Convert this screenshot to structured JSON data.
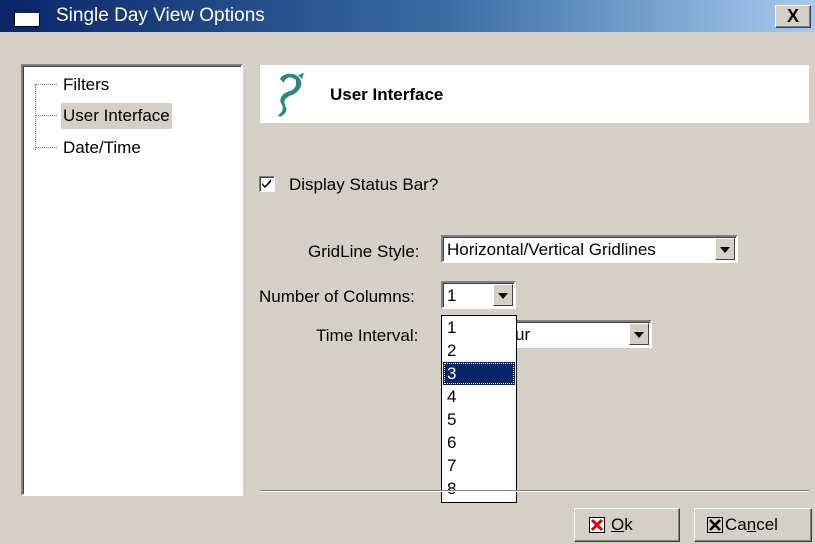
{
  "window": {
    "title": "Single Day View Options",
    "close_label": "X"
  },
  "tree": {
    "items": [
      {
        "label": "Filters",
        "selected": false
      },
      {
        "label": "User Interface",
        "selected": true
      },
      {
        "label": "Date/Time",
        "selected": false
      }
    ]
  },
  "header": {
    "title": "User Interface",
    "logo_icon": "seahorse-logo-icon"
  },
  "status_bar": {
    "label": "Display Status Bar?",
    "checked": true
  },
  "gridline": {
    "label": "GridLine Style:",
    "value": "Horizontal/Vertical Gridlines"
  },
  "columns": {
    "label": "Number of Columns:",
    "value": "1",
    "options": [
      "1",
      "2",
      "3",
      "4",
      "5",
      "6",
      "7",
      "8"
    ],
    "highlighted": "3"
  },
  "time_interval": {
    "label": "Time Interval:",
    "value_visible": "ur"
  },
  "buttons": {
    "ok": {
      "prefix": "O",
      "rest": "k"
    },
    "cancel": {
      "prefix": "Ca",
      "accel": "n",
      "rest": "cel"
    }
  },
  "colors": {
    "title_start": "#0a246a",
    "title_end": "#a6caf0",
    "face": "#d4d0c8",
    "selection": "#0a246a",
    "ok_icon": "#e00000",
    "logo": "#2a8a7a"
  }
}
